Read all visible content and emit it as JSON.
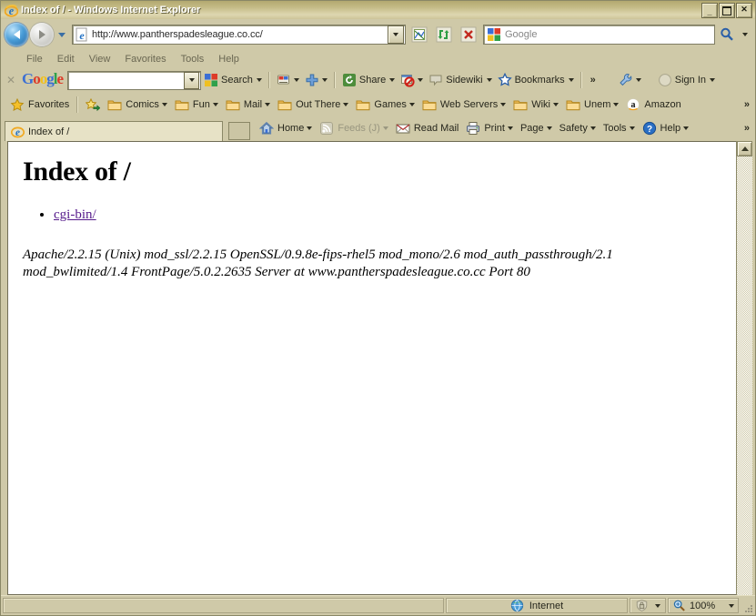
{
  "window": {
    "title": "Index of / - Windows Internet Explorer",
    "minimize_label": "_",
    "maximize_label": "",
    "close_label": "✕"
  },
  "address_bar": {
    "url": "http://www.pantherspadesleague.co.cc/",
    "back_tooltip": "Back",
    "forward_tooltip": "Forward",
    "recent_pages_tooltip": "Recent Pages",
    "compat_tooltip": "Compatibility View",
    "refresh_tooltip": "Refresh",
    "stop_tooltip": "Stop",
    "search_placeholder": "Google",
    "search_value": "",
    "search_button_tooltip": "Search"
  },
  "menu": {
    "items": [
      "File",
      "Edit",
      "View",
      "Favorites",
      "Tools",
      "Help"
    ]
  },
  "google_toolbar": {
    "close_label": "✕",
    "logo": {
      "g1": "G",
      "o1": "o",
      "o2": "o",
      "g2": "g",
      "l": "l",
      "e": "e"
    },
    "search_value": "",
    "items": [
      {
        "label": "Search",
        "icon": "google-icon",
        "has_dropdown": true
      },
      {
        "label": "",
        "icon": "translate-icon",
        "has_dropdown": true
      },
      {
        "label": "",
        "icon": "plus-icon",
        "has_dropdown": true
      },
      {
        "label": "Share",
        "icon": "share-icon",
        "has_dropdown": true
      },
      {
        "label": "",
        "icon": "blocked-popups-icon",
        "has_dropdown": true
      },
      {
        "label": "Sidewiki",
        "icon": "sidewiki-icon",
        "has_dropdown": true
      },
      {
        "label": "Bookmarks",
        "icon": "star-icon",
        "has_dropdown": true
      }
    ],
    "overflow_label": "»",
    "settings": {
      "label": "",
      "icon": "wrench-icon",
      "has_dropdown": true
    },
    "signin": {
      "label": "Sign In",
      "icon": "avatar-icon",
      "has_dropdown": true
    }
  },
  "favorites_bar": {
    "favorites_label": "Favorites",
    "add_tooltip": "Add to Favorites Bar",
    "items": [
      {
        "label": "Comics",
        "icon": "folder-icon",
        "has_dropdown": true
      },
      {
        "label": "Fun",
        "icon": "folder-icon",
        "has_dropdown": true
      },
      {
        "label": "Mail",
        "icon": "folder-icon",
        "has_dropdown": true
      },
      {
        "label": "Out There",
        "icon": "folder-icon",
        "has_dropdown": true
      },
      {
        "label": "Games",
        "icon": "folder-icon",
        "has_dropdown": true
      },
      {
        "label": "Web Servers",
        "icon": "folder-icon",
        "has_dropdown": true
      },
      {
        "label": "Wiki",
        "icon": "folder-icon",
        "has_dropdown": true
      },
      {
        "label": "Unem",
        "icon": "folder-icon",
        "has_dropdown": true
      },
      {
        "label": "Amazon",
        "icon": "amazon-icon",
        "has_dropdown": false
      }
    ],
    "overflow_label": "»"
  },
  "tabs": {
    "active": {
      "label": "Index of /",
      "icon": "ie-page-icon"
    },
    "new_tab_tooltip": "New Tab"
  },
  "command_bar": {
    "items": [
      {
        "label": "Home",
        "icon": "home-icon",
        "has_dropdown": true,
        "dimmed": false
      },
      {
        "label": "Feeds (J)",
        "icon": "feeds-icon",
        "has_dropdown": true,
        "dimmed": true
      },
      {
        "label": "Read Mail",
        "icon": "mail-icon",
        "has_dropdown": false,
        "dimmed": false
      },
      {
        "label": "Print",
        "icon": "printer-icon",
        "has_dropdown": true,
        "dimmed": false
      },
      {
        "label": "Page",
        "icon": "",
        "has_dropdown": true,
        "dimmed": false
      },
      {
        "label": "Safety",
        "icon": "",
        "has_dropdown": true,
        "dimmed": false
      },
      {
        "label": "Tools",
        "icon": "",
        "has_dropdown": true,
        "dimmed": false
      },
      {
        "label": "Help",
        "icon": "help-icon",
        "has_dropdown": true,
        "dimmed": false
      }
    ],
    "overflow_label": "»"
  },
  "page": {
    "heading": "Index of /",
    "entries": [
      {
        "label": "cgi-bin/",
        "href": "cgi-bin/"
      }
    ],
    "server_signature_line1": "Apache/2.2.15 (Unix) mod_ssl/2.2.15 OpenSSL/0.9.8e-fips-rhel5 mod_mono/2.6 mod_auth_passthrough/2.1",
    "server_signature_line2": "mod_bwlimited/1.4 FrontPage/5.0.2.2635 Server at www.pantherspadesleague.co.cc Port 80"
  },
  "status_bar": {
    "message": "",
    "zone_label": "Internet",
    "zone_icon": "globe-icon",
    "protected_mode_icon": "shield-icon",
    "zoom_label": "100%",
    "zoom_icon": "magnifier-icon"
  },
  "colors": {
    "chrome": "#cfc9a8",
    "titlebar_start": "#b3a970",
    "titlebar_end": "#cdc49a",
    "link_visited": "#551a8b",
    "page_bg": "#ffffff"
  }
}
